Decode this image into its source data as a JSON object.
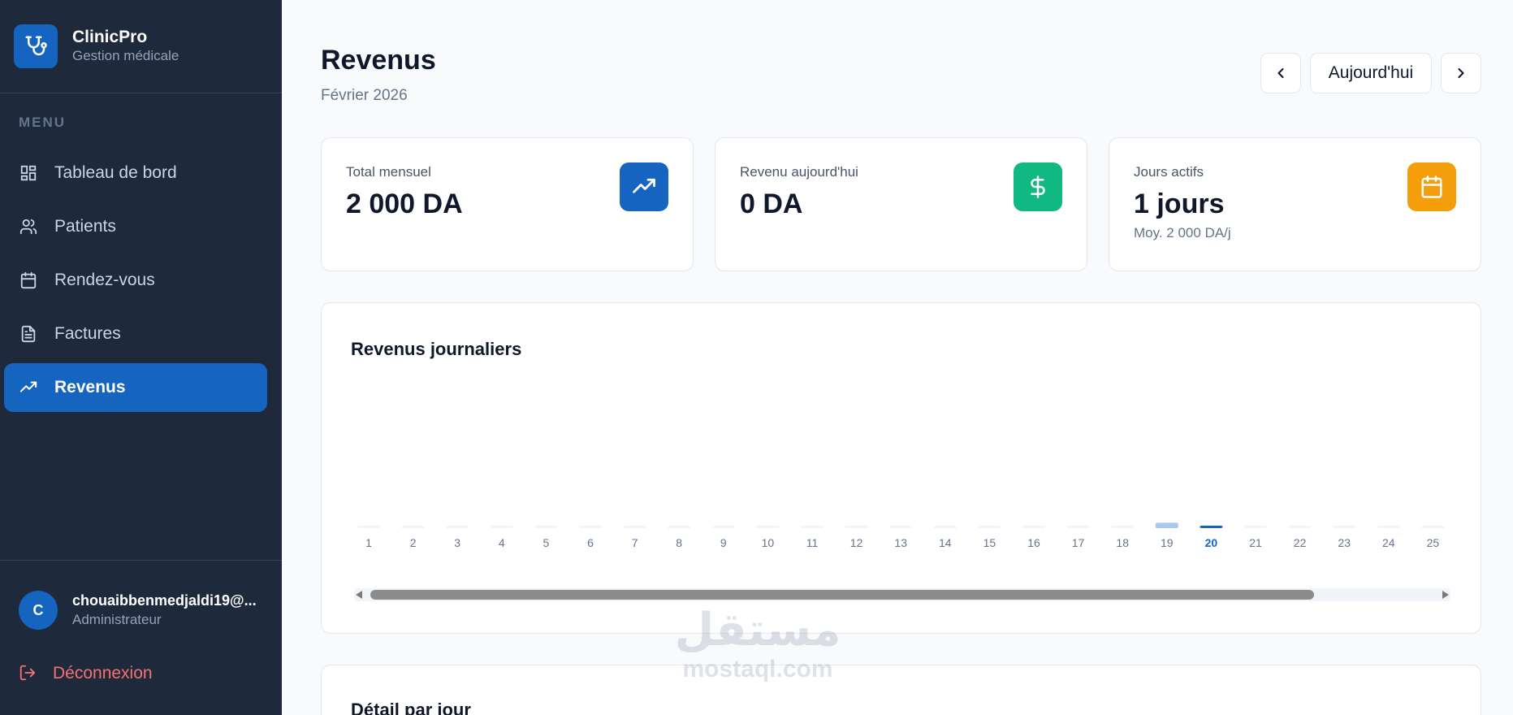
{
  "app": {
    "name": "ClinicPro",
    "tagline": "Gestion médicale"
  },
  "sidebar": {
    "menu_label": "MENU",
    "items": [
      {
        "label": "Tableau de bord",
        "icon": "dashboard-icon",
        "active": false
      },
      {
        "label": "Patients",
        "icon": "users-icon",
        "active": false
      },
      {
        "label": "Rendez-vous",
        "icon": "calendar-icon",
        "active": false
      },
      {
        "label": "Factures",
        "icon": "file-text-icon",
        "active": false
      },
      {
        "label": "Revenus",
        "icon": "trending-up-icon",
        "active": true
      }
    ],
    "user": {
      "initial": "C",
      "email": "chouaibbenmedjaldi19@...",
      "role": "Administrateur"
    },
    "logout_label": "Déconnexion"
  },
  "header": {
    "title": "Revenus",
    "period": "Février 2026",
    "today_label": "Aujourd'hui"
  },
  "stats": [
    {
      "label": "Total mensuel",
      "value": "2 000 DA",
      "note": "",
      "icon": "trending-up-icon",
      "color": "#1565c0"
    },
    {
      "label": "Revenu aujourd'hui",
      "value": "0 DA",
      "note": "",
      "icon": "dollar-icon",
      "color": "#10b981"
    },
    {
      "label": "Jours actifs",
      "value": "1 jours",
      "note": "Moy. 2 000 DA/j",
      "icon": "calendar-icon",
      "color": "#f59e0b"
    }
  ],
  "chart_panel": {
    "title": "Revenus journaliers"
  },
  "chart_data": {
    "type": "bar",
    "title": "Revenus journaliers",
    "categories": [
      "1",
      "2",
      "3",
      "4",
      "5",
      "6",
      "7",
      "8",
      "9",
      "10",
      "11",
      "12",
      "13",
      "14",
      "15",
      "16",
      "17",
      "18",
      "19",
      "20",
      "21",
      "22",
      "23",
      "24",
      "25"
    ],
    "values": [
      0,
      0,
      0,
      0,
      0,
      0,
      0,
      0,
      0,
      0,
      0,
      0,
      0,
      0,
      0,
      0,
      0,
      0,
      2000,
      0,
      0,
      0,
      0,
      0,
      0
    ],
    "highlight_category": "20",
    "ylim": [
      0,
      60000
    ],
    "grid": false,
    "colors": {
      "bar": "#a9c8ee",
      "empty": "#f1f5f9",
      "today": "#1565c0",
      "tick": "#64748b"
    }
  },
  "detail_panel": {
    "title": "Détail par jour"
  },
  "watermark": {
    "arabic": "مستقل",
    "latin": "mostaql.com"
  }
}
